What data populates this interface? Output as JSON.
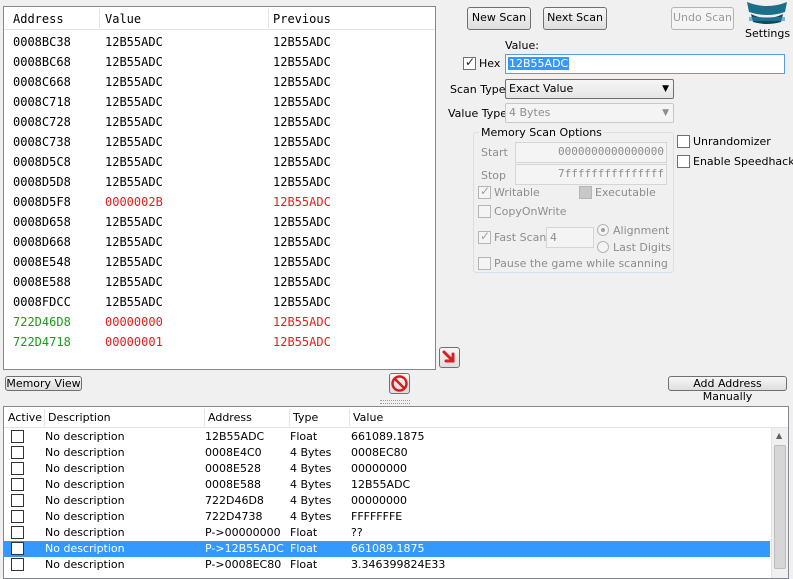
{
  "scan_results": {
    "headers": {
      "address": "Address",
      "value": "Value",
      "previous": "Previous"
    },
    "rows": [
      {
        "address": "0008BC38",
        "value": "12B55ADC",
        "previous": "12B55ADC",
        "addr_color": "#000000",
        "val_color": "#000000",
        "prev_color": "#000000"
      },
      {
        "address": "0008BC68",
        "value": "12B55ADC",
        "previous": "12B55ADC",
        "addr_color": "#000000",
        "val_color": "#000000",
        "prev_color": "#000000"
      },
      {
        "address": "0008C668",
        "value": "12B55ADC",
        "previous": "12B55ADC",
        "addr_color": "#000000",
        "val_color": "#000000",
        "prev_color": "#000000"
      },
      {
        "address": "0008C718",
        "value": "12B55ADC",
        "previous": "12B55ADC",
        "addr_color": "#000000",
        "val_color": "#000000",
        "prev_color": "#000000"
      },
      {
        "address": "0008C728",
        "value": "12B55ADC",
        "previous": "12B55ADC",
        "addr_color": "#000000",
        "val_color": "#000000",
        "prev_color": "#000000"
      },
      {
        "address": "0008C738",
        "value": "12B55ADC",
        "previous": "12B55ADC",
        "addr_color": "#000000",
        "val_color": "#000000",
        "prev_color": "#000000"
      },
      {
        "address": "0008D5C8",
        "value": "12B55ADC",
        "previous": "12B55ADC",
        "addr_color": "#000000",
        "val_color": "#000000",
        "prev_color": "#000000"
      },
      {
        "address": "0008D5D8",
        "value": "12B55ADC",
        "previous": "12B55ADC",
        "addr_color": "#000000",
        "val_color": "#000000",
        "prev_color": "#000000"
      },
      {
        "address": "0008D5F8",
        "value": "0000002B",
        "previous": "12B55ADC",
        "addr_color": "#000000",
        "val_color": "#e02020",
        "prev_color": "#e02020"
      },
      {
        "address": "0008D658",
        "value": "12B55ADC",
        "previous": "12B55ADC",
        "addr_color": "#000000",
        "val_color": "#000000",
        "prev_color": "#000000"
      },
      {
        "address": "0008D668",
        "value": "12B55ADC",
        "previous": "12B55ADC",
        "addr_color": "#000000",
        "val_color": "#000000",
        "prev_color": "#000000"
      },
      {
        "address": "0008E548",
        "value": "12B55ADC",
        "previous": "12B55ADC",
        "addr_color": "#000000",
        "val_color": "#000000",
        "prev_color": "#000000"
      },
      {
        "address": "0008E588",
        "value": "12B55ADC",
        "previous": "12B55ADC",
        "addr_color": "#000000",
        "val_color": "#000000",
        "prev_color": "#000000"
      },
      {
        "address": "0008FDCC",
        "value": "12B55ADC",
        "previous": "12B55ADC",
        "addr_color": "#000000",
        "val_color": "#000000",
        "prev_color": "#000000"
      },
      {
        "address": "722D46D8",
        "value": "00000000",
        "previous": "12B55ADC",
        "addr_color": "#1a9a1a",
        "val_color": "#e02020",
        "prev_color": "#e02020"
      },
      {
        "address": "722D4718",
        "value": "00000001",
        "previous": "12B55ADC",
        "addr_color": "#1a9a1a",
        "val_color": "#e02020",
        "prev_color": "#e02020"
      }
    ]
  },
  "buttons": {
    "new_scan": "New Scan",
    "next_scan": "Next Scan",
    "undo_scan": "Undo Scan",
    "settings": "Settings",
    "memory_view": "Memory View",
    "add_address_manually": "Add Address Manually"
  },
  "scan_form": {
    "value_label": "Value:",
    "hex_label": "Hex",
    "hex_checked": true,
    "value": "12B55ADC",
    "scan_type_label": "Scan Type",
    "scan_type": "Exact Value",
    "value_type_label": "Value Type",
    "value_type": "4 Bytes"
  },
  "memory_options": {
    "title": "Memory Scan Options",
    "start_label": "Start",
    "start_value": "0000000000000000",
    "stop_label": "Stop",
    "stop_value": "7fffffffffffffff",
    "writable": "Writable",
    "executable": "Executable",
    "copy_on_write": "CopyOnWrite",
    "fast_scan": "Fast Scan",
    "fast_scan_value": "4",
    "alignment": "Alignment",
    "last_digits": "Last Digits",
    "pause_game": "Pause the game while scanning"
  },
  "extra_options": {
    "unrandomizer": "Unrandomizer",
    "enable_speedhack": "Enable Speedhack"
  },
  "address_list": {
    "headers": {
      "active": "Active",
      "description": "Description",
      "address": "Address",
      "type": "Type",
      "value": "Value"
    },
    "rows": [
      {
        "description": "No description",
        "address": "12B55ADC",
        "type": "Float",
        "value": "661089.1875",
        "selected": false
      },
      {
        "description": "No description",
        "address": "0008E4C0",
        "type": "4 Bytes",
        "value": "0008EC80",
        "selected": false
      },
      {
        "description": "No description",
        "address": "0008E528",
        "type": "4 Bytes",
        "value": "00000000",
        "selected": false
      },
      {
        "description": "No description",
        "address": "0008E588",
        "type": "4 Bytes",
        "value": "12B55ADC",
        "selected": false
      },
      {
        "description": "No description",
        "address": "722D46D8",
        "type": "4 Bytes",
        "value": "00000000",
        "selected": false
      },
      {
        "description": "No description",
        "address": "722D4738",
        "type": "4 Bytes",
        "value": "FFFFFFFE",
        "selected": false
      },
      {
        "description": "No description",
        "address": "P->00000000",
        "type": "Float",
        "value": "??",
        "selected": false
      },
      {
        "description": "No description",
        "address": "P->12B55ADC",
        "type": "Float",
        "value": "661089.1875",
        "selected": true
      },
      {
        "description": "No description",
        "address": "P->0008EC80",
        "type": "Float",
        "value": "3.346399824E33",
        "selected": false
      }
    ]
  },
  "colors": {
    "selection": "#3399ff",
    "changed_value": "#e02020",
    "static_address": "#1a9a1a"
  }
}
